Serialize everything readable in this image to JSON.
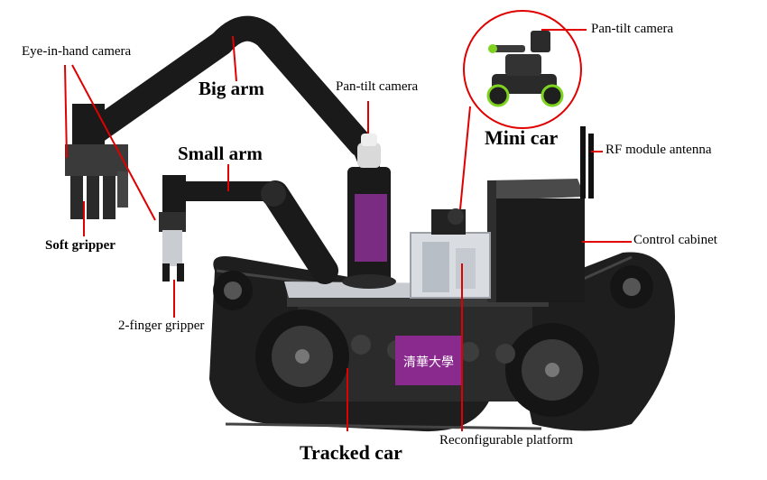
{
  "labels": {
    "eye_in_hand_camera": "Eye-in-hand camera",
    "big_arm": "Big arm",
    "pan_tilt_camera_main": "Pan-tilt camera",
    "pan_tilt_camera_mini": "Pan-tilt camera",
    "mini_car": "Mini car",
    "rf_module_antenna": "RF module antenna",
    "small_arm": "Small arm",
    "control_cabinet": "Control cabinet",
    "soft_gripper": "Soft gripper",
    "two_finger_gripper": "2-finger gripper",
    "reconfigurable_platform": "Reconfigurable platform",
    "tracked_car": "Tracked car"
  },
  "logo_text": "清華大學",
  "colors": {
    "leader_line": "#e00000",
    "robot_dark": "#1a1a1a",
    "track": "#262626",
    "panel_purple": "#8a2a8f",
    "accent_green": "#7ed321",
    "metal": "#c8ccd0"
  }
}
